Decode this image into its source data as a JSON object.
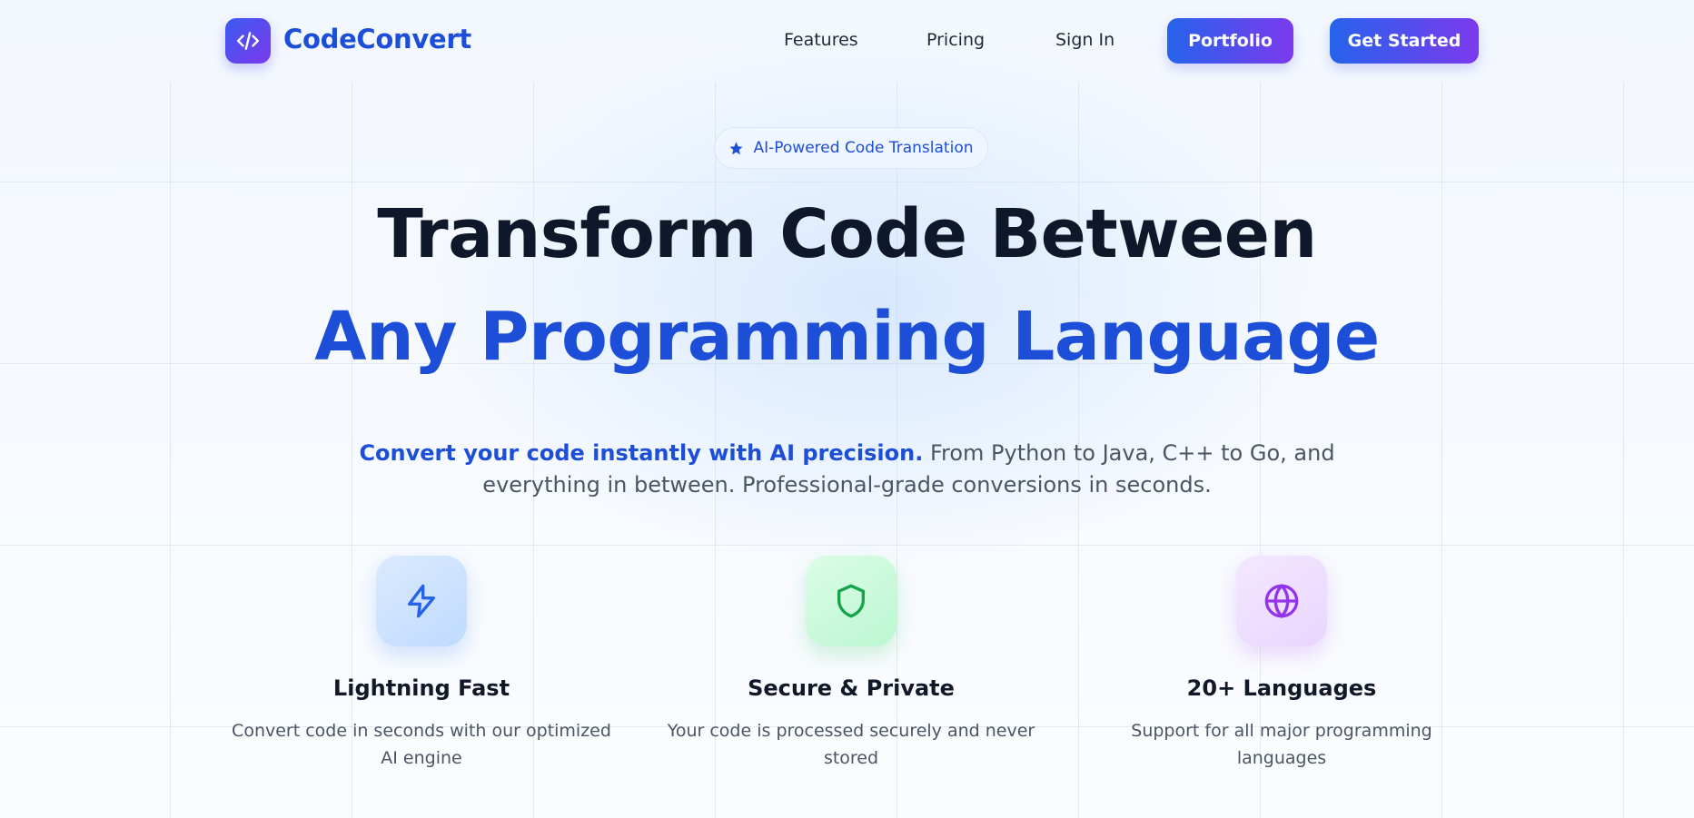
{
  "nav": {
    "brand": "CodeConvert",
    "links": [
      "Features",
      "Pricing",
      "Sign In"
    ],
    "portfolio_label": "Portfolio",
    "get_started_label": "Get Started"
  },
  "hero": {
    "badge": "AI-Powered Code Translation",
    "title_line1": "Transform Code Between",
    "title_line2": "Any Programming Language",
    "subtitle_bold": "Convert your code instantly with AI precision.",
    "subtitle_rest": " From Python to Java, C++ to Go, and everything in between. Professional-grade conversions in seconds."
  },
  "features": [
    {
      "title": "Lightning Fast",
      "desc": "Convert code in seconds with our optimized AI engine",
      "icon": "lightning-icon",
      "color": "#2563eb"
    },
    {
      "title": "Secure & Private",
      "desc": "Your code is processed securely and never stored",
      "icon": "shield-icon",
      "color": "#16a34a"
    },
    {
      "title": "20+ Languages",
      "desc": "Support for all major programming languages",
      "icon": "globe-icon",
      "color": "#9333ea"
    }
  ],
  "colors": {
    "brand_blue": "#1d4ed8",
    "gradient_start": "#2563eb",
    "gradient_end": "#7c3aed"
  }
}
